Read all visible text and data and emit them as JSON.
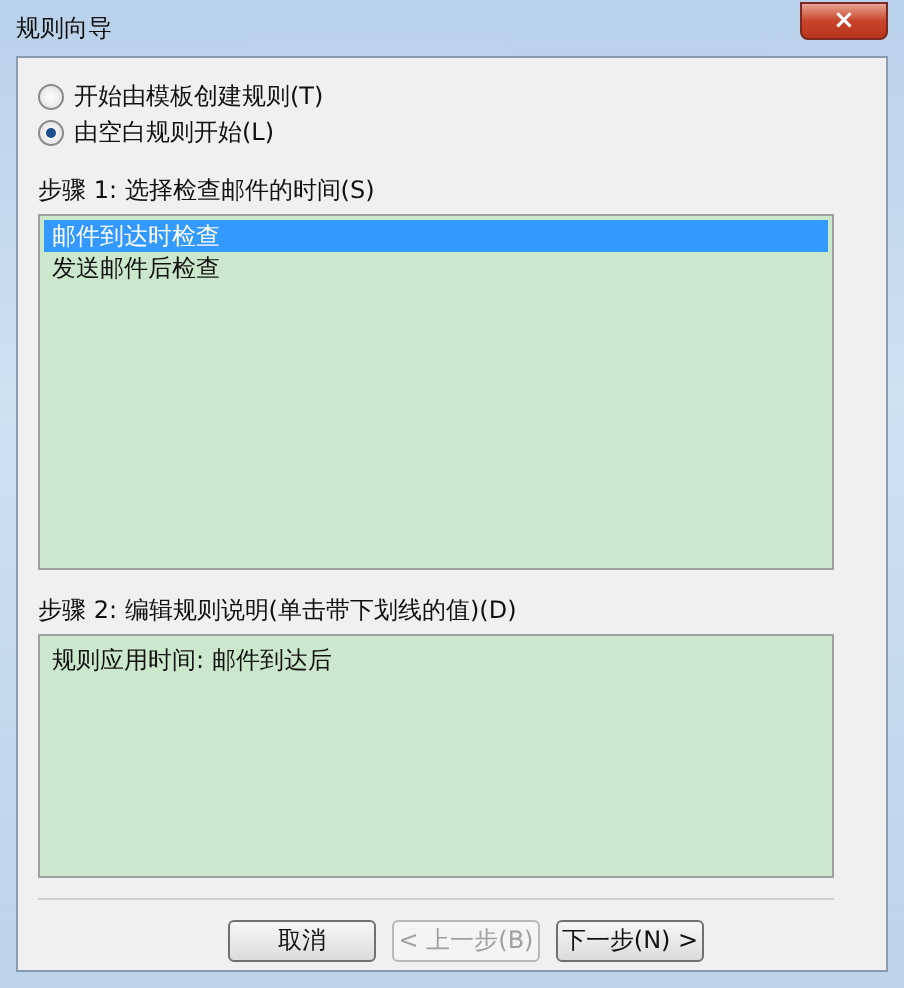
{
  "window": {
    "title": "规则向导",
    "close_label": "×"
  },
  "options": [
    {
      "label": "开始由模板创建规则(T)",
      "selected": false
    },
    {
      "label": "由空白规则开始(L)",
      "selected": true
    }
  ],
  "step1": {
    "label": "步骤 1: 选择检查邮件的时间(S)",
    "items": [
      {
        "label": "邮件到达时检查",
        "selected": true
      },
      {
        "label": "发送邮件后检查",
        "selected": false
      }
    ]
  },
  "step2": {
    "label": "步骤 2: 编辑规则说明(单击带下划线的值)(D)",
    "description": "规则应用时间: 邮件到达后"
  },
  "buttons": [
    {
      "label": "取消",
      "disabled": false
    },
    {
      "label": "< 上一步(B)",
      "disabled": true
    },
    {
      "label": "下一步(N) >",
      "disabled": false
    }
  ]
}
